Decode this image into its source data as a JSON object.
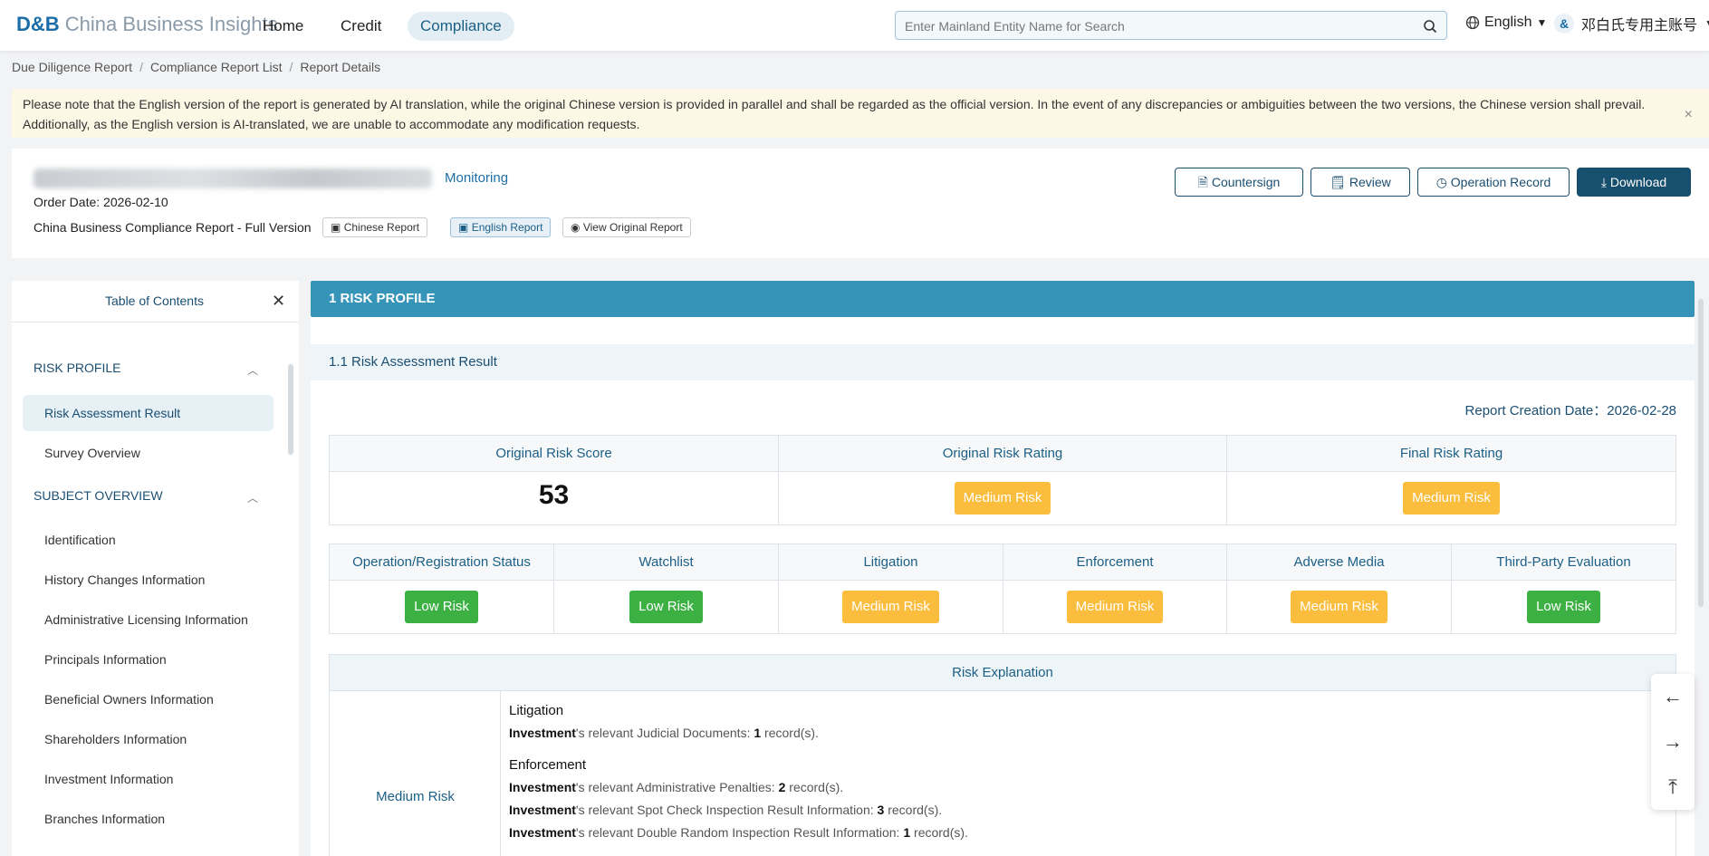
{
  "brand": {
    "logo_mark": "D&B",
    "name": "China Business Insights"
  },
  "nav": {
    "items": [
      {
        "label": "Home"
      },
      {
        "label": "Credit"
      },
      {
        "label": "Compliance"
      }
    ],
    "active": "Compliance"
  },
  "search": {
    "placeholder": "Enter Mainland Entity Name for Search",
    "icon": "search-icon"
  },
  "language": {
    "label": "English",
    "icon": "globe-icon"
  },
  "account": {
    "label": "邓白氏专用主账号",
    "avatar_icon": "dnb-avatar"
  },
  "breadcrumb": [
    "Due Diligence Report",
    "Compliance Report List",
    "Report Details"
  ],
  "notice": {
    "text": "Please note that the English version of the report is generated by AI translation, while the original Chinese version is provided in parallel and shall be regarded as the official version. In the event of any discrepancies or ambiguities between the two versions, the Chinese version shall prevail. Additionally, as the English version is AI-translated, we are unable to accommodate any modification requests.",
    "close": "×"
  },
  "report_header": {
    "monitoring": "Monitoring",
    "order_date": "Order Date: 2026-02-10",
    "report_type": "China Business Compliance Report - Full Version",
    "report_buttons": [
      {
        "label": "Chinese Report",
        "icon": "report-icon"
      },
      {
        "label": "English Report",
        "icon": "translate-icon"
      },
      {
        "label": "View Original Report",
        "icon": "eye-icon"
      }
    ],
    "actions": [
      {
        "label": "Countersign",
        "icon": "document-icon"
      },
      {
        "label": "Review",
        "icon": "review-icon"
      },
      {
        "label": "Operation Record",
        "icon": "clock-icon"
      },
      {
        "label": "Download",
        "icon": "download-icon"
      }
    ]
  },
  "toc": {
    "title": "Table of Contents",
    "sections": [
      {
        "label": "RISK PROFILE",
        "items": [
          "Risk Assessment Result",
          "Survey Overview"
        ]
      },
      {
        "label": "SUBJECT OVERVIEW",
        "items": [
          "Identification",
          "History Changes Information",
          "Administrative Licensing Information",
          "Principals Information",
          "Beneficial Owners Information",
          "Shareholders Information",
          "Investment Information",
          "Branches Information"
        ]
      }
    ],
    "active_item": "Risk Assessment Result"
  },
  "content": {
    "section_title": "1 RISK PROFILE",
    "subsection_title": "1.1 Risk Assessment Result",
    "creation_date": "Report Creation Date：2026-02-28",
    "summary": {
      "headers": [
        "Original Risk Score",
        "Original Risk Rating",
        "Final Risk Rating"
      ],
      "score": "53",
      "original_rating": "Medium Risk",
      "final_rating": "Medium Risk"
    },
    "dimensions": [
      {
        "name": "Operation/Registration Status",
        "rating": "Low Risk"
      },
      {
        "name": "Watchlist",
        "rating": "Low Risk"
      },
      {
        "name": "Litigation",
        "rating": "Medium Risk"
      },
      {
        "name": "Enforcement",
        "rating": "Medium Risk"
      },
      {
        "name": "Adverse Media",
        "rating": "Medium Risk"
      },
      {
        "name": "Third-Party Evaluation",
        "rating": "Low Risk"
      }
    ],
    "risk_explanation": {
      "title": "Risk Explanation",
      "level": "Medium Risk",
      "groups": [
        {
          "title": "Litigation",
          "lines": [
            {
              "entity": "Investment",
              "text": "'s relevant Judicial Documents: ",
              "count": "1",
              "suffix": " record(s)."
            }
          ]
        },
        {
          "title": "Enforcement",
          "lines": [
            {
              "entity": "Investment",
              "text": "'s relevant Administrative Penalties: ",
              "count": "2",
              "suffix": " record(s)."
            },
            {
              "entity": "Investment",
              "text": "'s relevant Spot Check Inspection Result Information: ",
              "count": "3",
              "suffix": " record(s)."
            },
            {
              "entity": "Investment",
              "text": "'s relevant Double Random Inspection Result Information: ",
              "count": "1",
              "suffix": " record(s)."
            }
          ]
        }
      ]
    }
  },
  "float_buttons": [
    {
      "icon": "arrow-left-icon"
    },
    {
      "icon": "arrow-right-icon"
    },
    {
      "icon": "back-to-top-icon"
    }
  ],
  "colors": {
    "low_risk": "#3cb043",
    "medium_risk": "#fbbd3d",
    "primary": "#17506f",
    "section": "#3594b7"
  }
}
